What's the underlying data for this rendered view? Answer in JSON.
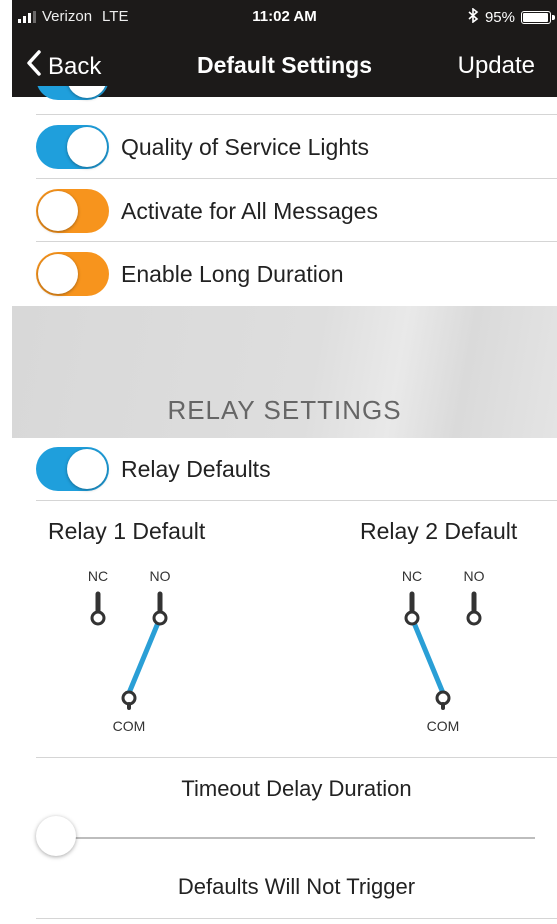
{
  "status_bar": {
    "carrier": "Verizon",
    "network": "LTE",
    "time": "11:02 AM",
    "battery_percent": "95%"
  },
  "nav": {
    "back_label": "Back",
    "title": "Default Settings",
    "update_label": "Update"
  },
  "toggles": [
    {
      "label": "Quality of Service Lights",
      "state": "on"
    },
    {
      "label": "Activate for All Messages",
      "state": "off"
    },
    {
      "label": "Enable Long Duration",
      "state": "off"
    }
  ],
  "relay_section": {
    "title": "RELAY SETTINGS",
    "relay_defaults": {
      "label": "Relay Defaults",
      "state": "on"
    },
    "relay1": {
      "title": "Relay 1 Default",
      "nc": "NC",
      "no": "NO",
      "com": "COM",
      "connected": "NO"
    },
    "relay2": {
      "title": "Relay 2 Default",
      "nc": "NC",
      "no": "NO",
      "com": "COM",
      "connected": "NC"
    }
  },
  "timeout": {
    "title": "Timeout Delay Duration",
    "slider_value": 0,
    "status": "Defaults Will Not Trigger"
  },
  "colors": {
    "accent_on": "#1f9fdc",
    "accent_off": "#f7941d",
    "topbar": "#1c1a19"
  }
}
